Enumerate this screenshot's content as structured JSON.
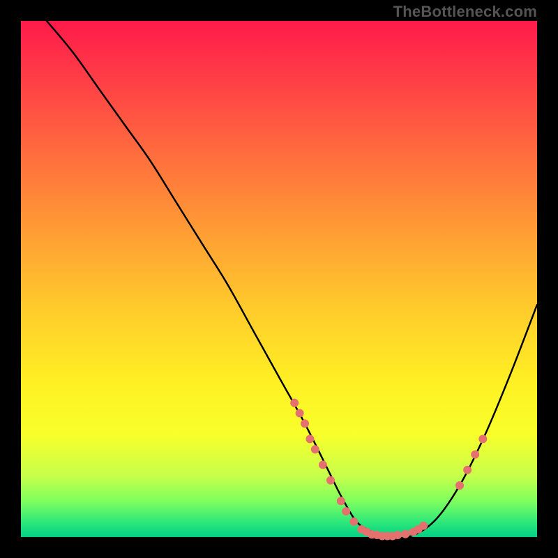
{
  "attribution": "TheBottleneck.com",
  "colors": {
    "frame": "#000000",
    "gradient_top": "#ff1a4a",
    "gradient_bottom": "#00d084",
    "curve": "#000000",
    "marker": "#e4716e"
  },
  "chart_data": {
    "type": "line",
    "title": "",
    "xlabel": "",
    "ylabel": "",
    "xlim": [
      0,
      100
    ],
    "ylim": [
      0,
      100
    ],
    "curve": {
      "x": [
        5,
        10,
        15,
        20,
        25,
        30,
        35,
        40,
        45,
        50,
        55,
        60,
        62,
        65,
        68,
        70,
        75,
        80,
        85,
        90,
        95,
        100
      ],
      "y": [
        100,
        94,
        87,
        80,
        73,
        65,
        57,
        49,
        40,
        31,
        22,
        12,
        8,
        3,
        1,
        0,
        0,
        3,
        10,
        20,
        32,
        45
      ]
    },
    "markers": [
      {
        "x": 53,
        "y": 26
      },
      {
        "x": 54,
        "y": 24
      },
      {
        "x": 55,
        "y": 22
      },
      {
        "x": 56,
        "y": 19
      },
      {
        "x": 57,
        "y": 17
      },
      {
        "x": 58.5,
        "y": 14
      },
      {
        "x": 60,
        "y": 11
      },
      {
        "x": 62,
        "y": 7
      },
      {
        "x": 63,
        "y": 5
      },
      {
        "x": 64.5,
        "y": 3
      },
      {
        "x": 66,
        "y": 1.5
      },
      {
        "x": 67,
        "y": 1
      },
      {
        "x": 68,
        "y": 0.5
      },
      {
        "x": 69,
        "y": 0.4
      },
      {
        "x": 70,
        "y": 0.2
      },
      {
        "x": 71,
        "y": 0.2
      },
      {
        "x": 72,
        "y": 0.2
      },
      {
        "x": 73,
        "y": 0.4
      },
      {
        "x": 74.5,
        "y": 0.6
      },
      {
        "x": 76,
        "y": 1
      },
      {
        "x": 77,
        "y": 1.5
      },
      {
        "x": 78,
        "y": 2.2
      },
      {
        "x": 85,
        "y": 10
      },
      {
        "x": 86.5,
        "y": 13
      },
      {
        "x": 88,
        "y": 16
      },
      {
        "x": 89.5,
        "y": 19
      }
    ]
  }
}
